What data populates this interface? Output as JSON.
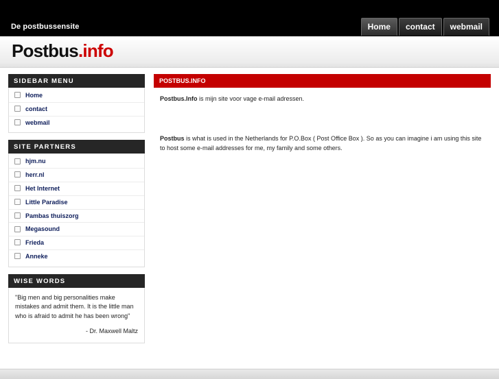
{
  "header": {
    "tagline": "De postbussensite",
    "nav": [
      {
        "label": "Home"
      },
      {
        "label": "contact"
      },
      {
        "label": "webmail"
      }
    ]
  },
  "logo": {
    "text": "Postbus",
    "accent": ".info"
  },
  "sidebar": {
    "menu": {
      "title": "SIDEBAR MENU",
      "items": [
        {
          "label": "Home"
        },
        {
          "label": "contact"
        },
        {
          "label": "webmail"
        }
      ]
    },
    "partners": {
      "title": "SITE PARTNERS",
      "items": [
        {
          "label": "hjm.nu"
        },
        {
          "label": "herr.nl"
        },
        {
          "label": "Het Internet"
        },
        {
          "label": "Little Paradise"
        },
        {
          "label": "Pambas thuiszorg"
        },
        {
          "label": "Megasound"
        },
        {
          "label": "Frieda"
        },
        {
          "label": "Anneke"
        }
      ]
    },
    "wise": {
      "title": "WISE WORDS",
      "quote": "\"Big men and big personalities make mistakes and admit them. It is the little man who is afraid to admit he has been wrong\"",
      "author": "- Dr. Maxwell Maltz"
    }
  },
  "main": {
    "title": "POSTBUS.INFO",
    "p1_strong": "Postbus.Info",
    "p1_rest": " is mijn site voor vage e-mail adressen.",
    "p2_strong": "Postbus",
    "p2_rest": " is what is used in the Netherlands for P.O.Box ( Post Office Box ). So as you can imagine i am using this site to host some e-mail addresses for me, my family and some others."
  },
  "colors": {
    "accent": "#c40000",
    "dark": "#262626",
    "link": "#0d1d5a"
  }
}
